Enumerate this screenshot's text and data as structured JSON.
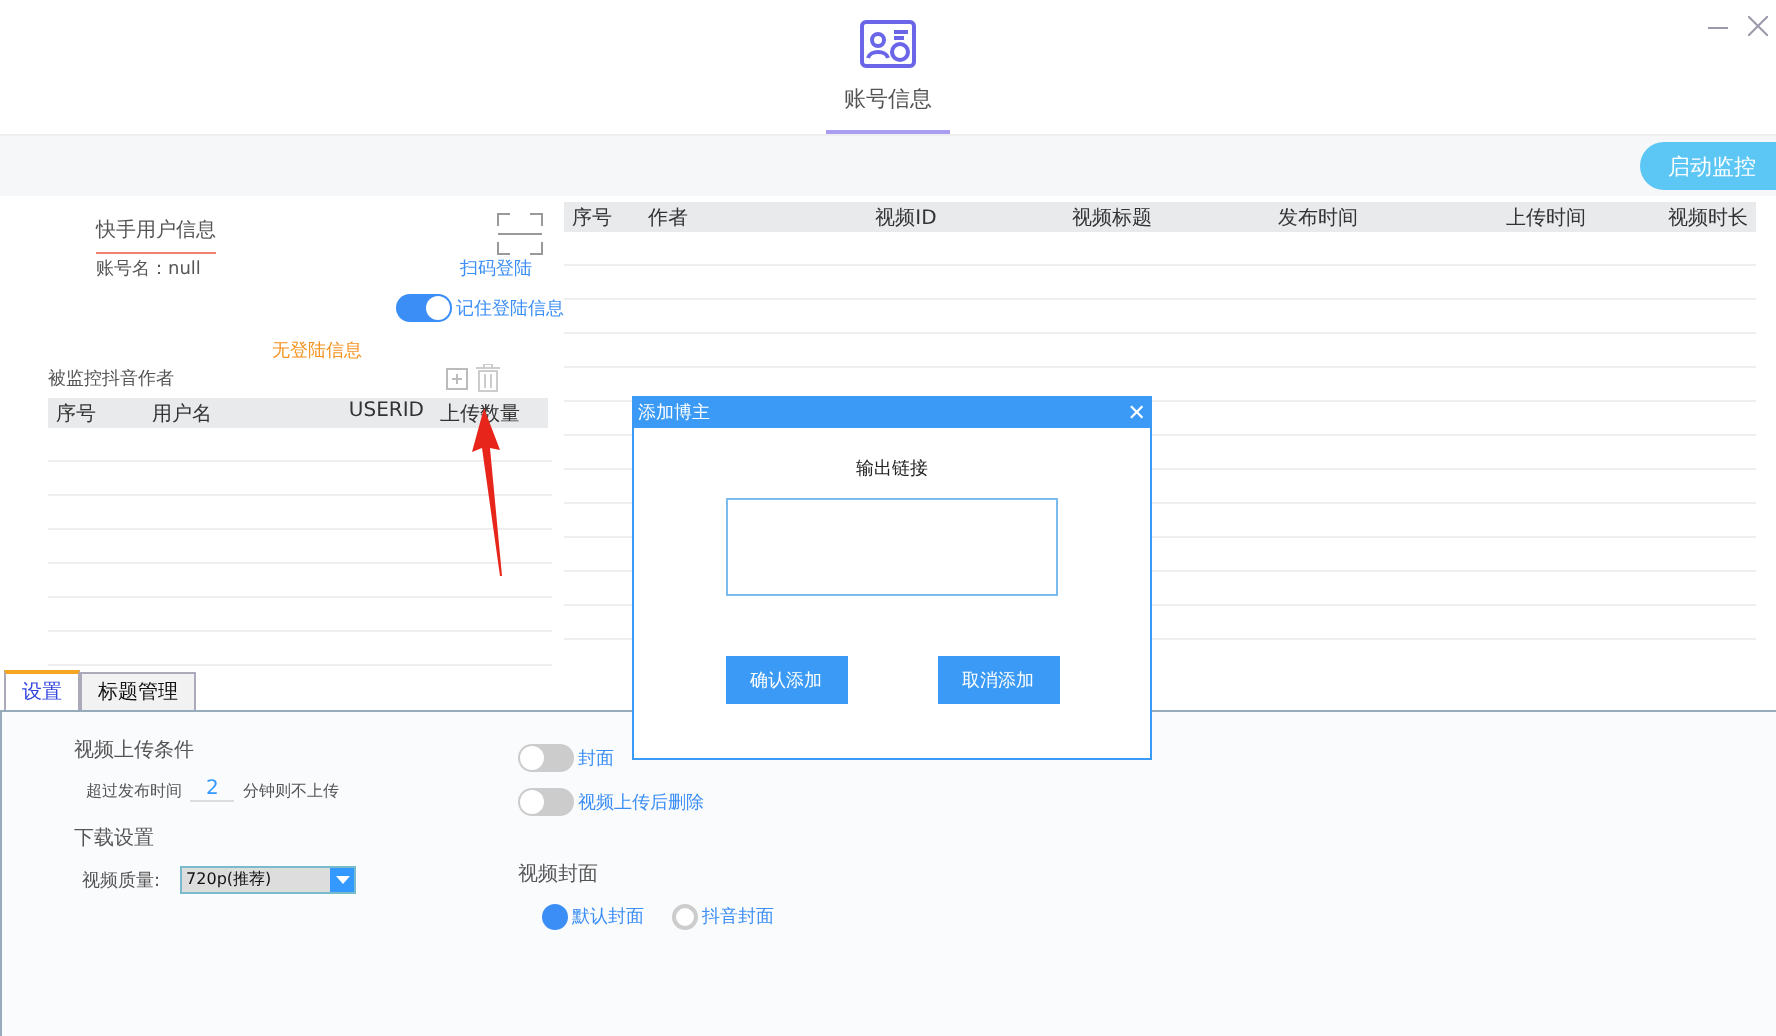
{
  "header": {
    "tab": {
      "label": "账号信息",
      "selected": true
    }
  },
  "toolbar": {
    "start_button": "启动监控"
  },
  "account": {
    "title": "快手用户信息",
    "account_name": "账号名：null",
    "scan_login": "扫码登陆",
    "remember": {
      "label": "记住登陆信息",
      "on": true
    },
    "status": "无登陆信息"
  },
  "authors": {
    "title": "被监控抖音作者",
    "columns": [
      "序号",
      "用户名",
      "USERID",
      "上传数量"
    ]
  },
  "videos": {
    "columns": [
      "序号",
      "作者",
      "视频ID",
      "视频标题",
      "发布时间",
      "上传时间",
      "视频时长"
    ]
  },
  "tabs": [
    {
      "label": "设置",
      "selected": true
    },
    {
      "label": "标题管理",
      "selected": false
    }
  ],
  "settings": {
    "upload_title": "视频上传条件",
    "exceed_label": "超过发布时间",
    "minutes": "2",
    "exceed_suffix": "分钟则不上传",
    "download_title": "下载设置",
    "quality_label": "视频质量:",
    "quality": "720p(推荐)",
    "toggles": [
      {
        "label": "封面",
        "on": false
      },
      {
        "label": "视频上传后删除",
        "on": false
      }
    ],
    "cover_title": "视频封面",
    "covers": [
      {
        "label": "默认封面",
        "selected": true
      },
      {
        "label": "抖音封面",
        "selected": false
      }
    ]
  },
  "dialog": {
    "title": "添加博主",
    "close": "✕",
    "field_label": "输出链接",
    "buttons": [
      "确认添加",
      "取消添加"
    ]
  }
}
